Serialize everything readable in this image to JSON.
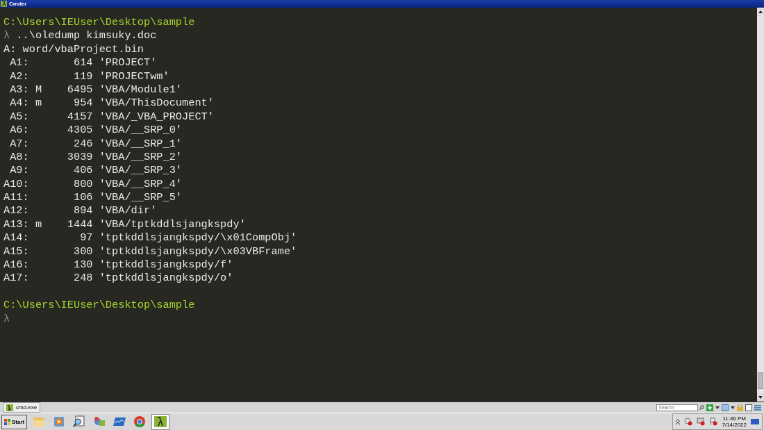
{
  "window": {
    "title": "Cmder"
  },
  "terminal": {
    "lines": [
      {
        "kind": "path",
        "text": "C:\\Users\\IEUser\\Desktop\\sample"
      },
      {
        "kind": "command",
        "prompt": "λ",
        "text": "..\\oledump kimsuky.doc"
      },
      {
        "kind": "output",
        "text": "A: word/vbaProject.bin"
      },
      {
        "kind": "output",
        "text": " A1:       614 'PROJECT'"
      },
      {
        "kind": "output",
        "text": " A2:       119 'PROJECTwm'"
      },
      {
        "kind": "output",
        "text": " A3: M    6495 'VBA/Module1'"
      },
      {
        "kind": "output",
        "text": " A4: m     954 'VBA/ThisDocument'"
      },
      {
        "kind": "output",
        "text": " A5:      4157 'VBA/_VBA_PROJECT'"
      },
      {
        "kind": "output",
        "text": " A6:      4305 'VBA/__SRP_0'"
      },
      {
        "kind": "output",
        "text": " A7:       246 'VBA/__SRP_1'"
      },
      {
        "kind": "output",
        "text": " A8:      3039 'VBA/__SRP_2'"
      },
      {
        "kind": "output",
        "text": " A9:       406 'VBA/__SRP_3'"
      },
      {
        "kind": "output",
        "text": "A10:       800 'VBA/__SRP_4'"
      },
      {
        "kind": "output",
        "text": "A11:       106 'VBA/__SRP_5'"
      },
      {
        "kind": "output",
        "text": "A12:       894 'VBA/dir'"
      },
      {
        "kind": "output",
        "text": "A13: m    1444 'VBA/tptkddlsjangkspdy'"
      },
      {
        "kind": "output",
        "text": "A14:        97 'tptkddlsjangkspdy/\\x01CompObj'"
      },
      {
        "kind": "output",
        "text": "A15:       300 'tptkddlsjangkspdy/\\x03VBFrame'"
      },
      {
        "kind": "output",
        "text": "A16:       130 'tptkddlsjangkspdy/f'"
      },
      {
        "kind": "output",
        "text": "A17:       248 'tptkddlsjangkspdy/o'"
      },
      {
        "kind": "blank"
      },
      {
        "kind": "path",
        "text": "C:\\Users\\IEUser\\Desktop\\sample"
      },
      {
        "kind": "command",
        "prompt": "λ"
      }
    ]
  },
  "console_tabs": [
    {
      "label": "cmd.exe",
      "selected": true
    }
  ],
  "search": {
    "placeholder": "Search"
  },
  "taskbar": {
    "start": "Start",
    "apps": [
      {
        "kind": "folder",
        "selected": false
      },
      {
        "kind": "media",
        "selected": false
      },
      {
        "kind": "magnifier",
        "selected": false
      },
      {
        "kind": "network",
        "selected": false
      },
      {
        "kind": "monitor",
        "selected": false
      },
      {
        "kind": "browser",
        "selected": false
      },
      {
        "kind": "lambda",
        "selected": true
      }
    ],
    "clock": {
      "time": "11:46 PM",
      "date": "7/14/2022"
    }
  }
}
